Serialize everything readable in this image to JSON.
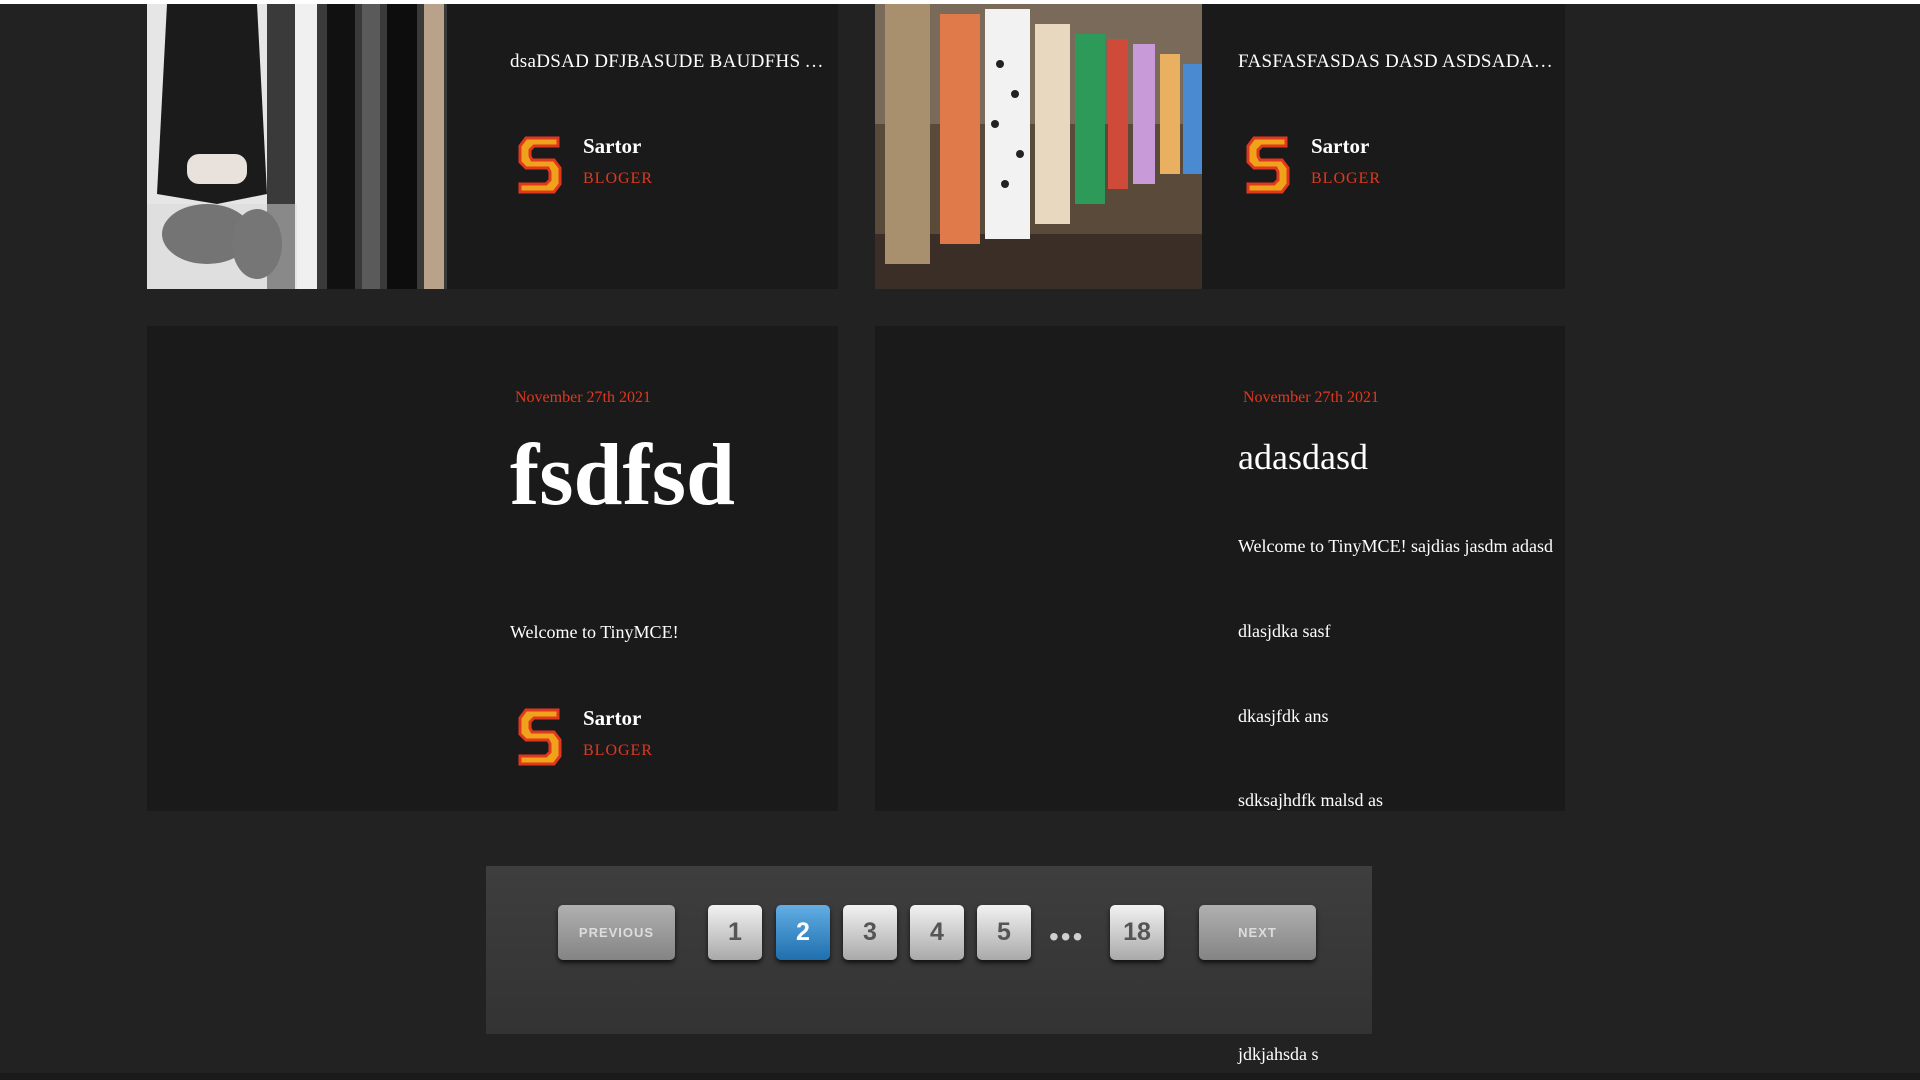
{
  "author": {
    "name": "Sartor",
    "role": "BLOGER",
    "logo_icon": "sartor-s-logo-icon"
  },
  "posts_top": [
    {
      "title": "dsaDSAD DFJBASUDE BAUDFHS ASDNAS",
      "image": "fashion-wardrobe-photo"
    },
    {
      "title": "FASFASFASDAS DASD ASDSADASDA",
      "image": "runway-models-photo"
    }
  ],
  "posts_bottom": [
    {
      "date": "November 27th 2021",
      "title": "fsdfsd",
      "body": [
        "Welcome to TinyMCE!"
      ]
    },
    {
      "date": "November 27th 2021",
      "title": "adasdasd",
      "body": [
        "Welcome to TinyMCE! sajdias jasdm adasd",
        "dlasjdka sasf",
        "dkasjfdk ans",
        "sdksajhdfk malsd as",
        "jdkjahsda s"
      ]
    }
  ],
  "pagination": {
    "previous_label": "PREVIOUS",
    "next_label": "NEXT",
    "pages": [
      "1",
      "2",
      "3",
      "4",
      "5",
      "18"
    ],
    "ellipsis": "•••",
    "current_page": "2"
  },
  "colors": {
    "accent": "#e0381f",
    "page_bg": "#222222",
    "card_bg": "#1a1a1a",
    "active_page": "#3a8fd0"
  }
}
